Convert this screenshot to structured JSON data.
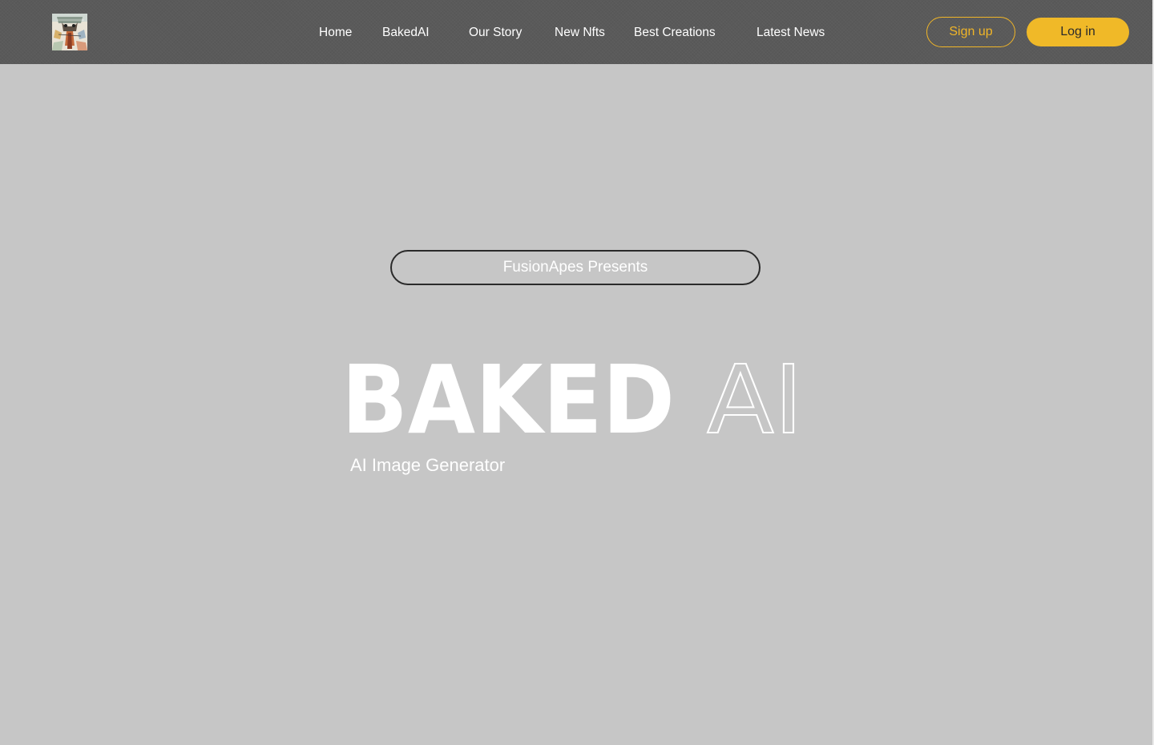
{
  "brand": {
    "logo_icon": "nft-artwork-thumbnail"
  },
  "nav": {
    "items": [
      {
        "label": "Home"
      },
      {
        "label": "BakedAI"
      },
      {
        "label": "Our Story"
      },
      {
        "label": "New Nfts"
      },
      {
        "label": "Best Creations"
      },
      {
        "label": "Latest News"
      }
    ]
  },
  "auth": {
    "signup_label": "Sign up",
    "login_label": "Log in"
  },
  "hero": {
    "presenter": "FusionApes Presents",
    "title_solid": "BAKED",
    "title_outline": "AI",
    "subtitle": "AI Image Generator"
  },
  "colors": {
    "page_background": "#c6c6c6",
    "navbar_background": "#5a5a5a",
    "accent_yellow": "#f0b928",
    "text_white": "#ffffff",
    "pill_border": "#2a2a2a"
  }
}
